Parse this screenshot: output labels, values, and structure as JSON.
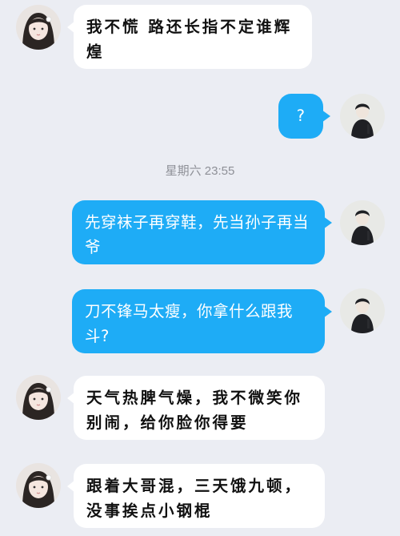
{
  "conversation": {
    "messages": [
      {
        "side": "left",
        "text": "我不慌 路还长指不定谁辉煌"
      },
      {
        "side": "right",
        "text": "?"
      },
      {
        "side": "right",
        "text": "先穿袜子再穿鞋，先当孙子再当爷"
      },
      {
        "side": "right",
        "text": "刀不锋马太瘦，你拿什么跟我斗?"
      },
      {
        "side": "left",
        "text": "天气热脾气燥，我不微笑你别闹，给你脸你得要"
      },
      {
        "side": "left",
        "text": "跟着大哥混，三天饿九顿，没事挨点小钢棍"
      }
    ],
    "timestamp": "星期六 23:55"
  },
  "colors": {
    "background": "#ebedf3",
    "outgoing_bubble": "#1eacf6",
    "incoming_bubble": "#ffffff",
    "timestamp_text": "#8e9097"
  },
  "icons": {
    "girl_avatar": "girl-avatar",
    "boy_avatar": "boy-avatar"
  }
}
